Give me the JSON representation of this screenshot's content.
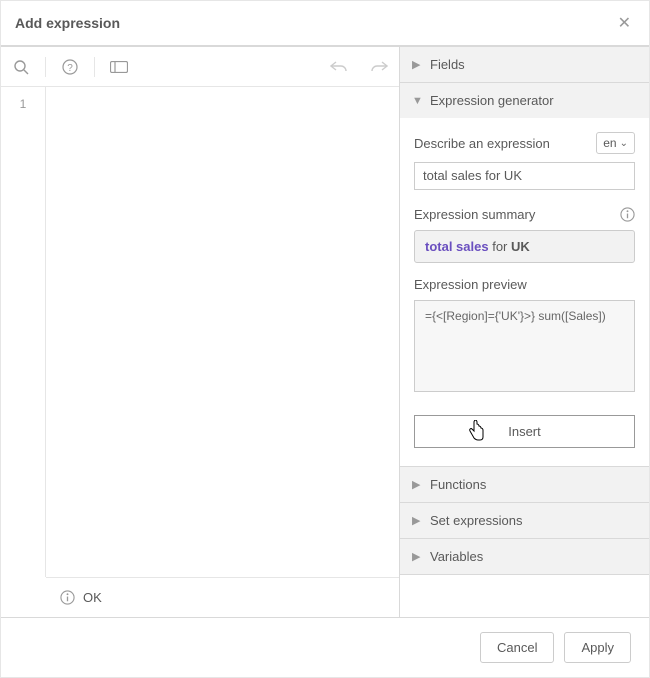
{
  "dialog": {
    "title": "Add expression"
  },
  "editor": {
    "line_number": "1",
    "status": "OK"
  },
  "right": {
    "sections": {
      "fields": "Fields",
      "expr_gen": "Expression generator",
      "functions": "Functions",
      "set_expr": "Set expressions",
      "variables": "Variables"
    },
    "gen": {
      "describe_label": "Describe an expression",
      "lang": "en",
      "describe_value": "total sales for UK",
      "summary_label": "Expression summary",
      "summary_parts": {
        "measure": "total sales",
        "mid": " for ",
        "dim": "UK"
      },
      "preview_label": "Expression preview",
      "preview_value": "={<[Region]={'UK'}>} sum([Sales])",
      "insert_label": "Insert"
    }
  },
  "footer": {
    "cancel": "Cancel",
    "apply": "Apply"
  }
}
